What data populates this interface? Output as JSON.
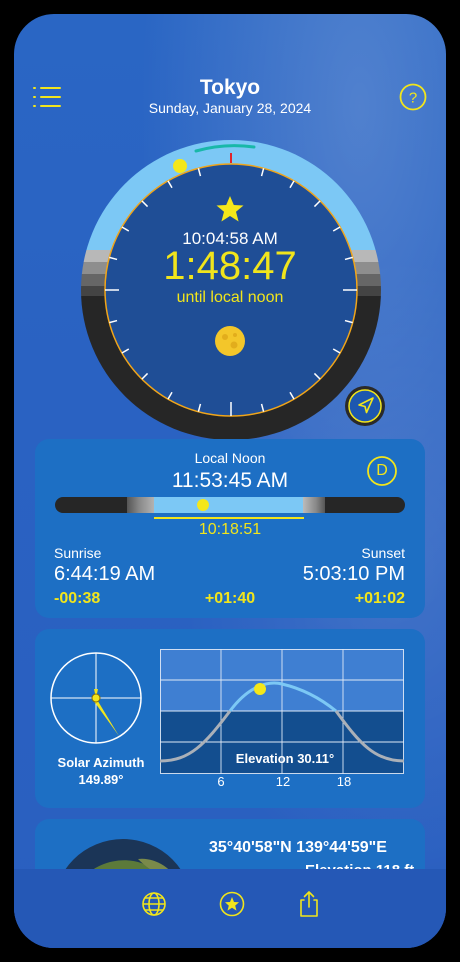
{
  "header": {
    "city": "Tokyo",
    "date": "Sunday, January 28, 2024",
    "menu_icon": "list-icon",
    "help_icon": "question-circle-icon"
  },
  "clock": {
    "current_time": "10:04:58 AM",
    "countdown": "1:48:47",
    "countdown_label": "until local noon",
    "sun_marker_icon": "star-icon",
    "moon_icon": "moon-icon",
    "locate_icon": "location-arrow-icon"
  },
  "daylight": {
    "title": "Local Noon",
    "noon_time": "11:53:45 AM",
    "mode_badge": "D",
    "day_length": "10:18:51",
    "sunrise_label": "Sunrise",
    "sunrise_time": "6:44:19 AM",
    "sunrise_delta": "-00:38",
    "daylength_delta": "+01:40",
    "sunset_label": "Sunset",
    "sunset_time": "5:03:10 PM",
    "sunset_delta": "+01:02"
  },
  "position": {
    "azimuth_label": "Solar Azimuth",
    "azimuth_value": "149.89°",
    "elevation_label": "Elevation 30.11°",
    "x_ticks": [
      "6",
      "12",
      "18"
    ]
  },
  "location": {
    "coordinates": "35°40'58\"N 139°44'59\"E",
    "elevation_partial": "Elevation 118 ft"
  },
  "tabbar": {
    "tabs": [
      {
        "icon": "globe-icon"
      },
      {
        "icon": "star-circle-icon"
      },
      {
        "icon": "share-icon"
      }
    ]
  },
  "colors": {
    "accent_yellow": "#f1e51c",
    "sky_blue": "#7cc8f5",
    "card_blue": "#1d6fc4"
  }
}
